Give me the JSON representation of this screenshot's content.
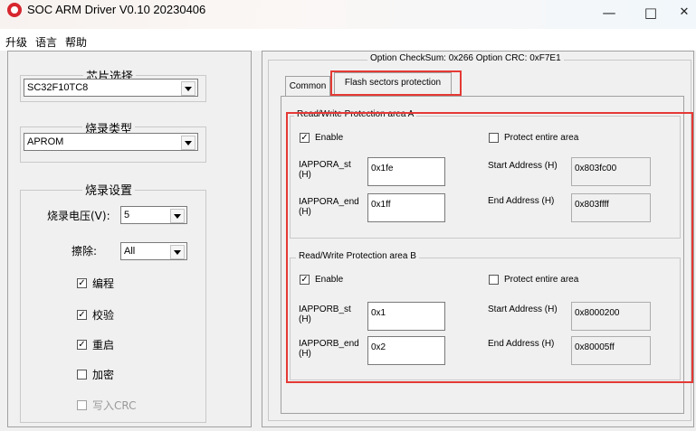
{
  "window": {
    "title": "SOC ARM Driver V0.10 20230406",
    "min": "—",
    "max": "□",
    "close": "✕"
  },
  "menu": [
    "升级",
    "语言",
    "帮助"
  ],
  "left": {
    "chip": {
      "legend": "芯片选择",
      "value": "SC32F10TC8"
    },
    "burn_type": {
      "legend": "烧录类型",
      "value": "APROM"
    },
    "settings": {
      "legend": "烧录设置",
      "voltage_label": "烧录电压(V):",
      "voltage_value": "5",
      "erase_label": "擦除:",
      "erase_value": "All",
      "options": [
        {
          "label": "编程",
          "checked": true,
          "enabled": true
        },
        {
          "label": "校验",
          "checked": true,
          "enabled": true
        },
        {
          "label": "重启",
          "checked": true,
          "enabled": true
        },
        {
          "label": "加密",
          "checked": false,
          "enabled": true
        },
        {
          "label": "写入CRC",
          "checked": false,
          "enabled": false
        }
      ]
    }
  },
  "right": {
    "header": "Option CheckSum:  0x266  Option CRC:  0xF7E1",
    "tabs": [
      "Common",
      "Flash sectors protection"
    ],
    "areaA": {
      "legend": "Read/Write Protection area A",
      "enable": "Enable",
      "protect_all": "Protect entire area",
      "st_label": "IAPPORA_st\n(H)",
      "st_value": "0x1fe",
      "end_label": "IAPPORA_end\n(H)",
      "end_value": "0x1ff",
      "start_addr_label": "Start Address (H)",
      "start_addr": "0x803fc00",
      "end_addr_label": "End Address  (H)",
      "end_addr": "0x803ffff"
    },
    "areaB": {
      "legend": "Read/Write Protection area B",
      "enable": "Enable",
      "protect_all": "Protect entire area",
      "st_label": "IAPPORB_st\n(H)",
      "st_value": "0x1",
      "end_label": "IAPPORB_end\n(H)",
      "end_value": "0x2",
      "start_addr_label": "Start Address (H)",
      "start_addr": "0x8000200",
      "end_addr_label": "End Address  (H)",
      "end_addr": "0x80005ff"
    }
  },
  "colors": {
    "highlight": "#e53935",
    "logo": "#d7262e"
  }
}
